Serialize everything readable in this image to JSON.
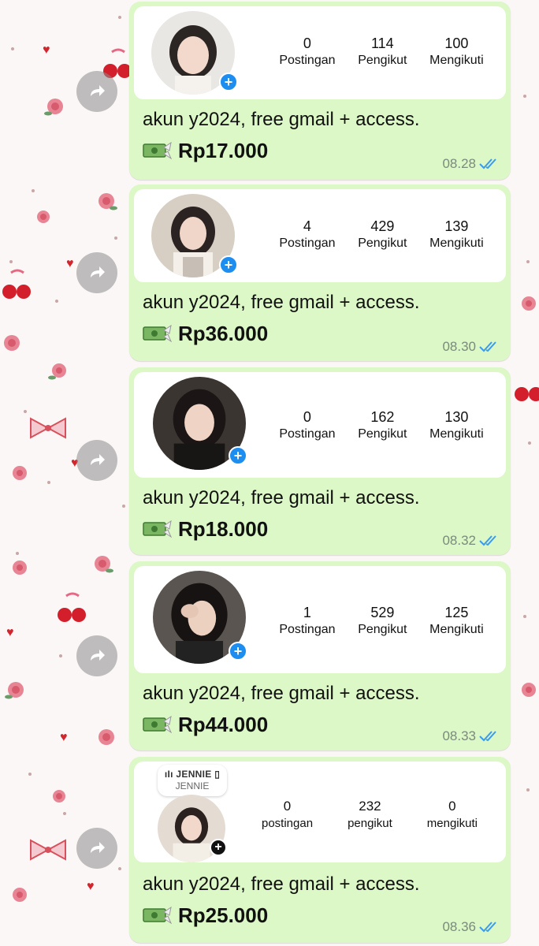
{
  "theme": {
    "bubble_color": "#dcf8c6",
    "tick_color": "#3a9bf0",
    "avatar_plus_color": "#1d8ef0"
  },
  "icons": {
    "forward": "forward-arrow-icon",
    "money": "money-with-wings-emoji",
    "read_receipt": "double-check-icon"
  },
  "messages": [
    {
      "stats": [
        {
          "value": "0",
          "label": "Postingan"
        },
        {
          "value": "114",
          "label": "Pengikut"
        },
        {
          "value": "100",
          "label": "Mengikuti"
        }
      ],
      "text": "akun y2024, free gmail + access.",
      "price": "Rp17.000",
      "time": "08.28"
    },
    {
      "stats": [
        {
          "value": "4",
          "label": "Postingan"
        },
        {
          "value": "429",
          "label": "Pengikut"
        },
        {
          "value": "139",
          "label": "Mengikuti"
        }
      ],
      "text": "akun y2024, free gmail + access.",
      "price": "Rp36.000",
      "time": "08.30"
    },
    {
      "stats": [
        {
          "value": "0",
          "label": "Postingan"
        },
        {
          "value": "162",
          "label": "Pengikut"
        },
        {
          "value": "130",
          "label": "Mengikuti"
        }
      ],
      "text": "akun y2024, free gmail + access.",
      "price": "Rp18.000",
      "time": "08.32"
    },
    {
      "stats": [
        {
          "value": "1",
          "label": "Postingan"
        },
        {
          "value": "529",
          "label": "Pengikut"
        },
        {
          "value": "125",
          "label": "Mengikuti"
        }
      ],
      "text": "akun y2024, free gmail + access.",
      "price": "Rp44.000",
      "time": "08.33"
    },
    {
      "note": {
        "line1": "ıIı JENNIE ▯",
        "line2": "JENNIE"
      },
      "stats": [
        {
          "value": "0",
          "label": "postingan"
        },
        {
          "value": "232",
          "label": "pengikut"
        },
        {
          "value": "0",
          "label": "mengikuti"
        }
      ],
      "text": "akun y2024, free gmail + access.",
      "price": "Rp25.000",
      "time": "08.36"
    }
  ]
}
